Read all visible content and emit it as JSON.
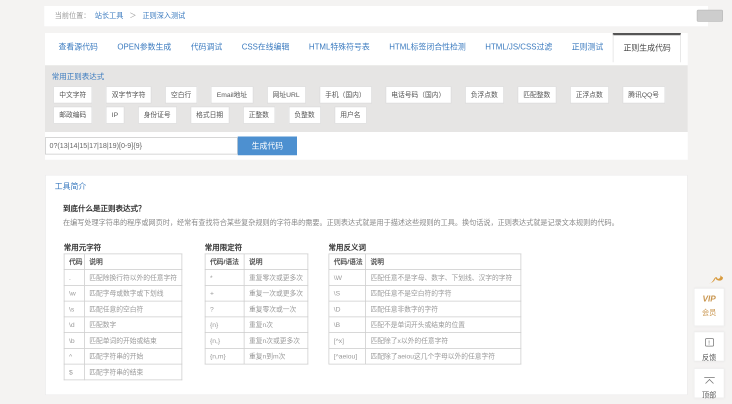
{
  "breadcrumb": {
    "label": "当前位置：",
    "link1": "站长工具",
    "separator": "＞",
    "link2": "正则深入测试"
  },
  "tabs": [
    {
      "label": "查看源代码",
      "active": false
    },
    {
      "label": "OPEN参数生成",
      "active": false
    },
    {
      "label": "代码调试",
      "active": false
    },
    {
      "label": "CSS在线编辑",
      "active": false
    },
    {
      "label": "HTML特殊符号表",
      "active": false
    },
    {
      "label": "HTML标签闭合性检测",
      "active": false
    },
    {
      "label": "HTML/JS/CSS过滤",
      "active": false
    },
    {
      "label": "正则测试",
      "active": false
    },
    {
      "label": "正则生成代码",
      "active": true
    }
  ],
  "regex_section": {
    "title": "常用正则表达式",
    "buttons": [
      "中文字符",
      "双字节字符",
      "空白行",
      "Email地址",
      "网址URL",
      "手机（国内）",
      "电话号码（国内）",
      "负浮点数",
      "匹配整数",
      "正浮点数",
      "腾讯QQ号",
      "邮政编码",
      "IP",
      "身份证号",
      "格式日期",
      "正整数",
      "负整数",
      "用户名"
    ],
    "input_value": "0?(13|14|15|17|18|19)[0-9]{9}",
    "generate_label": "生成代码"
  },
  "intro": {
    "title": "工具简介",
    "question": "到底什么是正则表达式？",
    "paragraph": "在编写处理字符串的程序或网页时，经常有查找符合某些复杂规则的字符串的需要。正则表达式就是用于描述这些规则的工具。换句话说，正则表达式就是记录文本规则的代码。",
    "tables": [
      {
        "title": "常用元字符",
        "headers": [
          "代码",
          "说明"
        ],
        "rows": [
          [
            ".",
            "匹配除换行符以外的任意字符"
          ],
          [
            "\\w",
            "匹配字母或数字或下划线"
          ],
          [
            "\\s",
            "匹配任意的空白符"
          ],
          [
            "\\d",
            "匹配数字"
          ],
          [
            "\\b",
            "匹配单词的开始或结束"
          ],
          [
            "^",
            "匹配字符串的开始"
          ],
          [
            "$",
            "匹配字符串的结束"
          ]
        ]
      },
      {
        "title": "常用限定符",
        "headers": [
          "代码/语法",
          "说明"
        ],
        "rows": [
          [
            "*",
            "重复零次或更多次"
          ],
          [
            "+",
            "重复一次或更多次"
          ],
          [
            "?",
            "重复零次或一次"
          ],
          [
            "{n}",
            "重复n次"
          ],
          [
            "{n,}",
            "重复n次或更多次"
          ],
          [
            "{n,m}",
            "重复n到m次"
          ]
        ]
      },
      {
        "title": "常用反义词",
        "headers": [
          "代码/语法",
          "说明"
        ],
        "rows": [
          [
            "\\W",
            "匹配任意不是字母、数字、下划线、汉字的字符"
          ],
          [
            "\\S",
            "匹配任意不是空白符的字符"
          ],
          [
            "\\D",
            "匹配任意非数字的字符"
          ],
          [
            "\\B",
            "匹配不是单词开头或结束的位置"
          ],
          [
            "[^x]",
            "匹配除了x以外的任意字符"
          ],
          [
            "[^aeiou]",
            "匹配除了aeiou这几个字母以外的任意字符"
          ]
        ]
      }
    ]
  },
  "floating": {
    "vip": "VIP",
    "vip_sub": "会员",
    "feedback": "反馈",
    "top": "顶部"
  },
  "colors": {
    "accent_blue": "#3a7abf",
    "button_blue": "#4d90d0",
    "vip_gold": "#c9964f",
    "band_gray": "#e6e5e4"
  }
}
